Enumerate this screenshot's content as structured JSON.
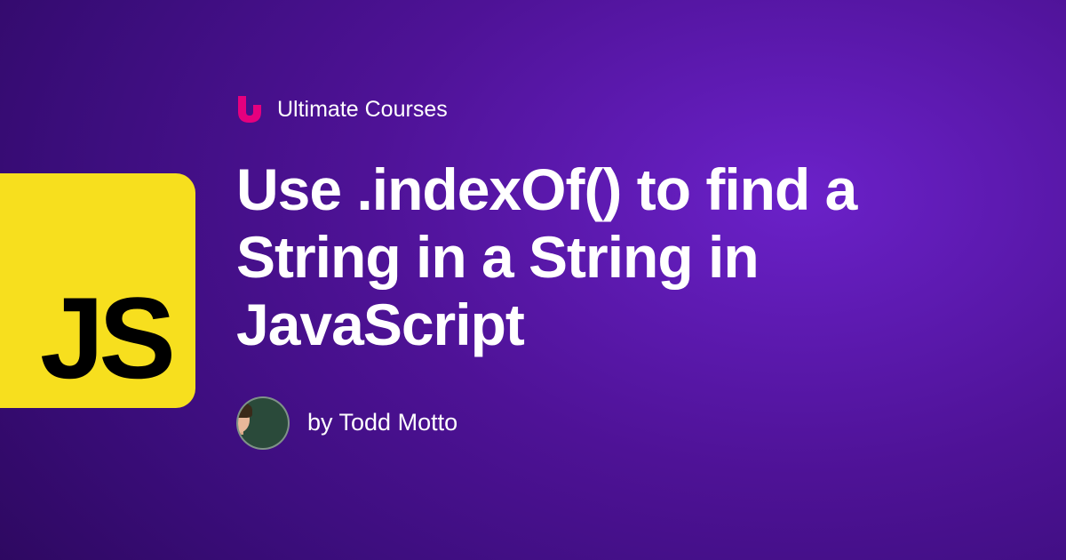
{
  "badge": {
    "text": "JS"
  },
  "brand": {
    "name": "Ultimate Courses"
  },
  "post": {
    "title": "Use .indexOf() to find a String in a String in JavaScript"
  },
  "author": {
    "byline": "by Todd Motto"
  },
  "colors": {
    "badge_bg": "#f7df1e",
    "badge_text": "#000000",
    "logo_accent": "#e6007e",
    "text": "#ffffff"
  }
}
